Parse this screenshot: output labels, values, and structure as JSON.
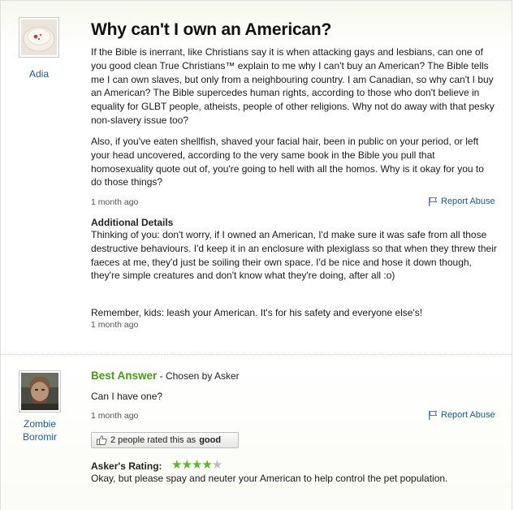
{
  "question": {
    "asker_name": "Adia",
    "title": "Why can't I own an American?",
    "body_p1": "If the Bible is inerrant, like Christians say it is when attacking gays and lesbians, can one of you good clean True Christians™ explain to me why I can't buy an American? The Bible tells me I can own slaves, but only from a neighbouring country. I am Canadian, so why can't I buy an American? The Bible supercedes human rights, according to those who don't believe in equality for GLBT people, atheists, people of other religions. Why not do away with that pesky non-slavery issue too?",
    "body_p2": "Also, if you've eaten shellfish, shaved your facial hair, been in public on your period, or left your head uncovered, according to the very same book in the Bible you pull that homosexuality quote out of, you're going to hell with all the homos. Why is it okay for you to do those things?",
    "time": "1 month ago",
    "report_label": "Report Abuse",
    "additional_title": "Additional Details",
    "additional_p1": "Thinking of you: don't worry, if I owned an American, I'd make sure it was safe from all those destructive behaviours. I'd keep it in an enclosure with plexiglass so that when they threw their faeces at me, they'd just be soiling their own space. I'd be nice and hose it down though, they're simple creatures and don't know what they're doing, after all :o)",
    "additional_p2": "Remember, kids: leash your American. It's for his safety and everyone else's!",
    "additional_time": "1 month ago"
  },
  "answer": {
    "answerer_name_line1": "Zombie",
    "answerer_name_line2": "Boromir",
    "best_label": "Best Answer",
    "chosen_by": " - Chosen by Asker",
    "text": "Can I have one?",
    "time": "1 month ago",
    "report_label": "Report Abuse",
    "rated_text_pre": "2 people rated this as ",
    "rated_text_bold": "good",
    "askers_rating_label": "Asker's Rating:",
    "rating": {
      "value": 4,
      "max": 5,
      "star_on": "★★★★",
      "star_off": "★"
    },
    "rating_comment": "Okay, but please spay and neuter your American to help control the pet population."
  },
  "colors": {
    "accent_green": "#4a9b1c",
    "link_blue": "#1a5c93",
    "star_green": "#5cb82a"
  }
}
